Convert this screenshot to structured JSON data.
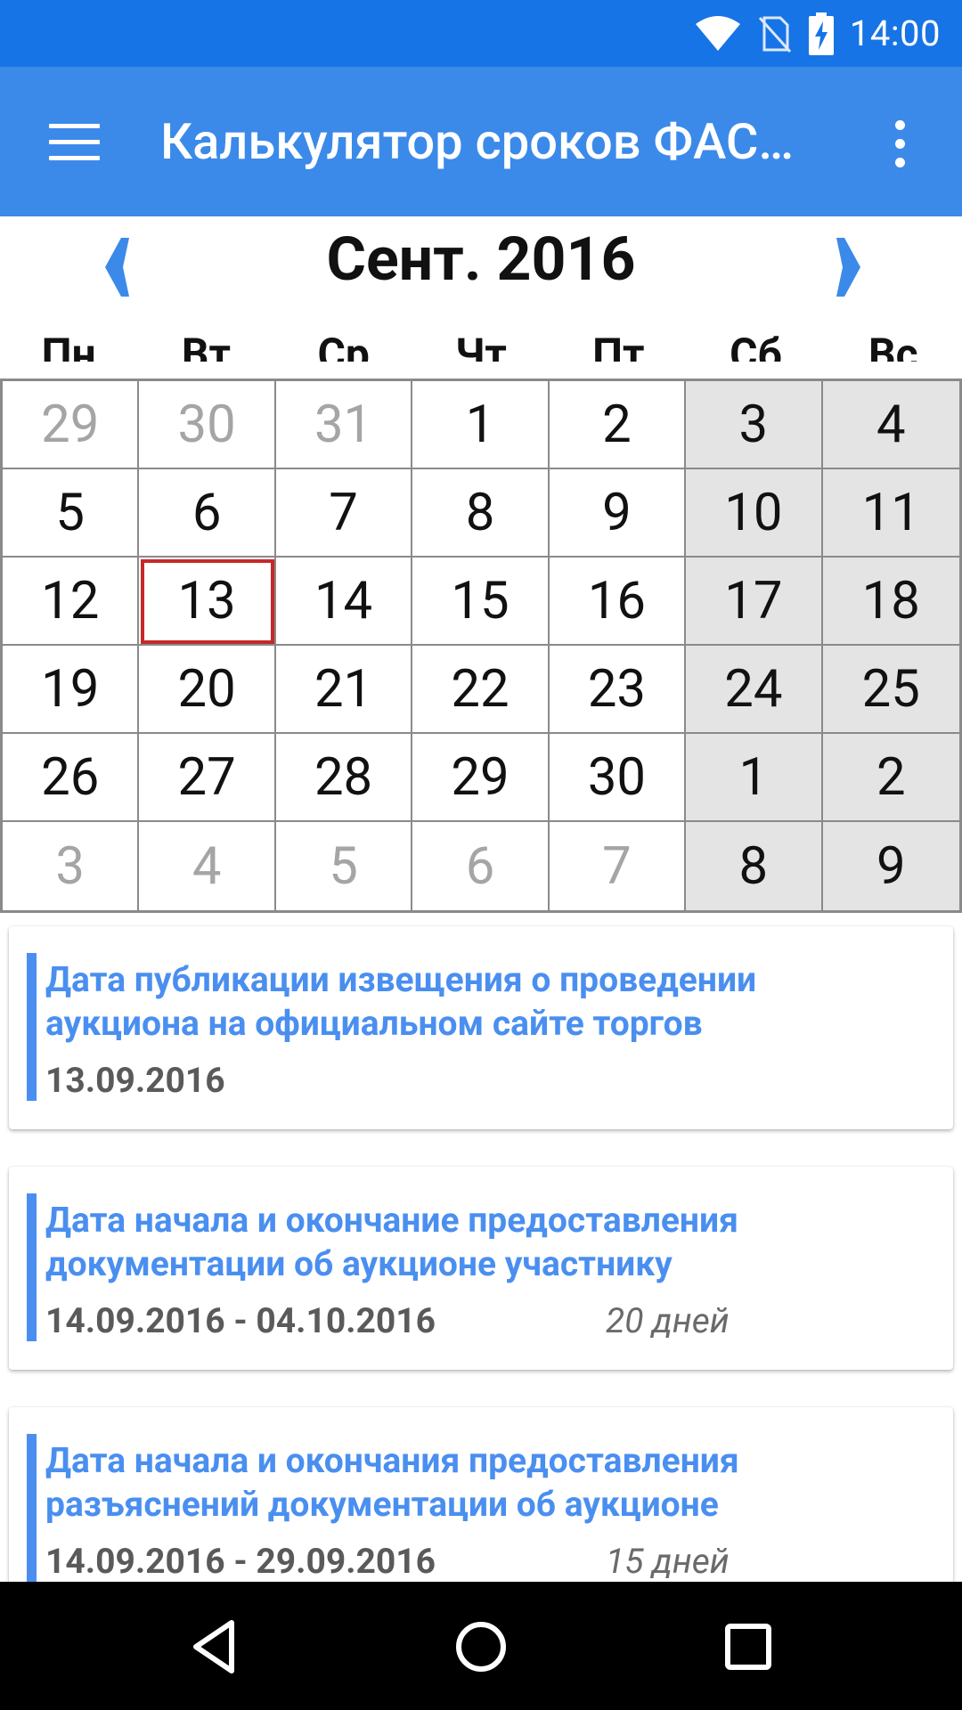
{
  "status_bar": {
    "time": "14:00",
    "icons": [
      "wifi-icon",
      "no-sim-icon",
      "battery-charging-icon"
    ]
  },
  "app_bar": {
    "title": "Калькулятор сроков ФАС…",
    "icons": [
      "menu-icon",
      "overflow-menu-icon"
    ]
  },
  "calendar": {
    "month_title": "Сент. 2016",
    "prev_icon": "chevron-left-icon",
    "next_icon": "chevron-right-icon",
    "weekdays": [
      "Пн",
      "Вт",
      "Ср",
      "Чт",
      "Пт",
      "Сб",
      "Вс"
    ],
    "weeks": [
      [
        "29",
        "30",
        "31",
        "1",
        "2",
        "3",
        "4"
      ],
      [
        "5",
        "6",
        "7",
        "8",
        "9",
        "10",
        "11"
      ],
      [
        "12",
        "13",
        "14",
        "15",
        "16",
        "17",
        "18"
      ],
      [
        "19",
        "20",
        "21",
        "22",
        "23",
        "24",
        "25"
      ],
      [
        "26",
        "27",
        "28",
        "29",
        "30",
        "1",
        "2"
      ],
      [
        "3",
        "4",
        "5",
        "6",
        "7",
        "8",
        "9"
      ]
    ],
    "other_month_cells": [
      [
        0,
        0
      ],
      [
        0,
        1
      ],
      [
        0,
        2
      ],
      [
        5,
        0
      ],
      [
        5,
        1
      ],
      [
        5,
        2
      ],
      [
        5,
        3
      ],
      [
        5,
        4
      ],
      [
        5,
        5
      ],
      [
        5,
        6
      ],
      [
        4,
        5
      ],
      [
        4,
        6
      ]
    ],
    "selected_day": "13",
    "colors": {
      "weekend_bg": "#e4e4e4",
      "other_month_text": "#a5a5a5",
      "selected_border": "#c62828",
      "grid_line": "#8a8a8a"
    }
  },
  "cards": [
    {
      "title": "Дата публикации извещения о проведении аукциона на официальном сайте торгов",
      "dates": "13.09.2016",
      "days": ""
    },
    {
      "title": "Дата начала и окончание предоставления документации об аукционе участнику",
      "dates": "14.09.2016 - 04.10.2016",
      "days": "20 дней"
    },
    {
      "title": "Дата начала и окончания предоставления разъяснений документации об аукционе",
      "dates": "14.09.2016 - 29.09.2016",
      "days": "15 дней"
    }
  ],
  "nav_bar": {
    "buttons": [
      "back-icon",
      "home-icon",
      "recent-apps-icon"
    ]
  },
  "colors": {
    "status_bar": "#1774e6",
    "app_bar": "#3b8ae9",
    "accent": "#4a8ff0"
  }
}
